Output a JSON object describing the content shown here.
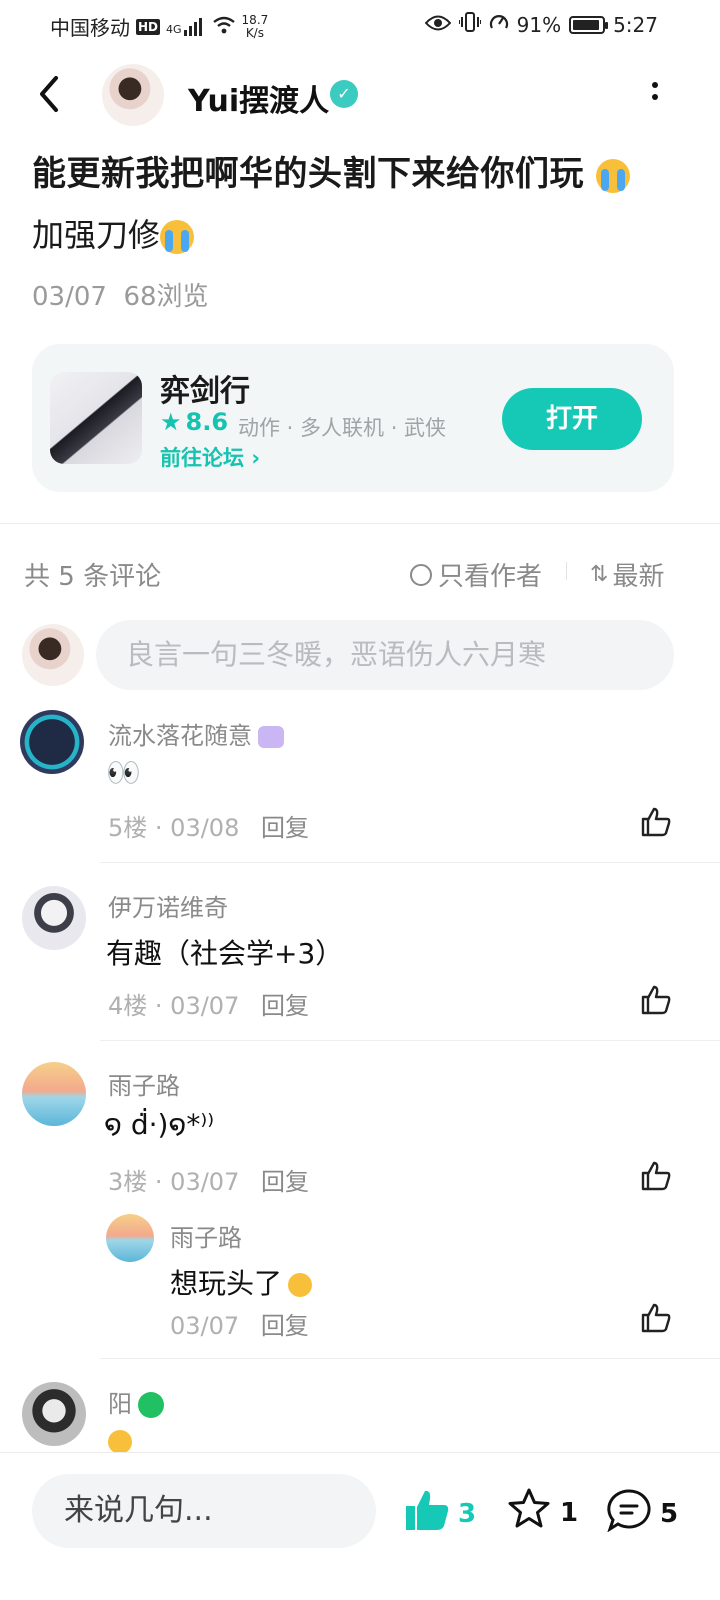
{
  "status_bar": {
    "carrier": "中国移动",
    "hd": "HD",
    "network": "4G",
    "speed_value": "18.7",
    "speed_unit": "K/s",
    "battery": "91%",
    "battery_level": 0.91,
    "time": "5:27"
  },
  "header": {
    "author": "Yui摆渡人"
  },
  "post": {
    "title": "能更新我把啊华的头割下来给你们玩",
    "body": "加强刀修",
    "date": "03/07",
    "views": "68浏览"
  },
  "game_card": {
    "name": "弈剑行",
    "rating": "8.6",
    "tags": "动作 · 多人联机 · 武侠",
    "forum_link": "前往论坛",
    "open_label": "打开"
  },
  "comments_header": {
    "count": "共 5 条评论",
    "only_author": "只看作者",
    "sort": "最新"
  },
  "comment_input": {
    "placeholder": "良言一句三冬暖，恶语伤人六月寒"
  },
  "comments": [
    {
      "name": "流水落花随意",
      "text": "👀",
      "floor": "5楼",
      "date": "03/08",
      "reply": "回复"
    },
    {
      "name": "伊万诺维奇",
      "text": "有趣（社会学+3）",
      "floor": "4楼",
      "date": "03/07",
      "reply": "回复"
    },
    {
      "name": "雨子路",
      "text": "໑ ḋ̇·)໑*⁾⁾",
      "floor": "3楼",
      "date": "03/07",
      "reply": "回复",
      "sub_reply": {
        "name": "雨子路",
        "text": "想玩头了",
        "date": "03/07",
        "reply": "回复"
      }
    },
    {
      "name": "阳",
      "text": ""
    }
  ],
  "bottom_bar": {
    "input_label": "来说几句...",
    "likes": "3",
    "favorites": "1",
    "comments": "5",
    "accent": "#16c9b6"
  }
}
